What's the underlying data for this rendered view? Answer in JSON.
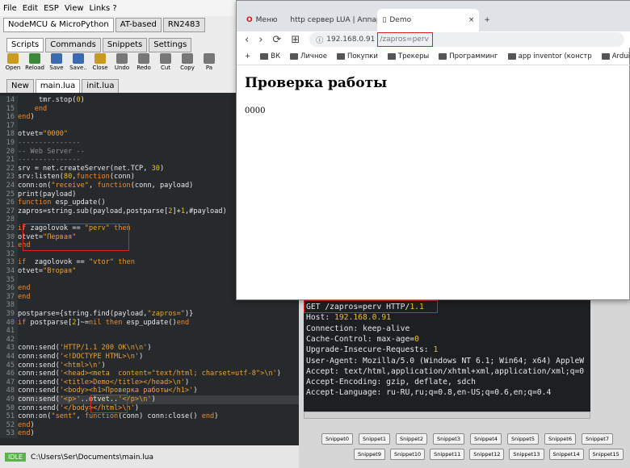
{
  "ide": {
    "menu": [
      "File",
      "Edit",
      "ESP",
      "View",
      "Links ?"
    ],
    "device_tabs": [
      "NodeMCU & MicroPython",
      "AT-based",
      "RN2483"
    ],
    "sub_tabs": [
      "Scripts",
      "Commands",
      "Snippets",
      "Settings"
    ],
    "toolbar": [
      "Open",
      "Reload",
      "Save",
      "Save..",
      "Close",
      "Undo",
      "Redo",
      "Cut",
      "Copy",
      "Pa"
    ],
    "file_tabs": [
      "New",
      "main.lua",
      "init.lua"
    ],
    "status": {
      "state": "IDLE",
      "path": "C:\\Users\\Ser\\Documents\\main.lua"
    },
    "code_lines": [
      {
        "n": "14",
        "t": "     tmr.stop(0)"
      },
      {
        "n": "15",
        "t": "    end"
      },
      {
        "n": "16",
        "t": "end)"
      },
      {
        "n": "17",
        "t": ""
      },
      {
        "n": "18",
        "t": "otvet=\"0000\""
      },
      {
        "n": "19",
        "t": "---------------"
      },
      {
        "n": "20",
        "t": "-- Web Server --"
      },
      {
        "n": "21",
        "t": "---------------"
      },
      {
        "n": "22",
        "t": "srv = net.createServer(net.TCP, 30)"
      },
      {
        "n": "23",
        "t": "srv:listen(80,function(conn)"
      },
      {
        "n": "24",
        "t": "conn:on(\"receive\", function(conn, payload)"
      },
      {
        "n": "25",
        "t": "print(payload)"
      },
      {
        "n": "26",
        "t": "function esp_update()"
      },
      {
        "n": "27",
        "t": "zapros=string.sub(payload,postparse[2]+1,#payload)"
      },
      {
        "n": "28",
        "t": ""
      },
      {
        "n": "29",
        "t": "if zagolovok == \"perv\" then"
      },
      {
        "n": "30",
        "t": "otvet=\"Первая\""
      },
      {
        "n": "31",
        "t": "end"
      },
      {
        "n": "32",
        "t": ""
      },
      {
        "n": "33",
        "t": "if  zagolovok == \"vtor\" then"
      },
      {
        "n": "34",
        "t": "otvet=\"Вторая\""
      },
      {
        "n": "35",
        "t": ""
      },
      {
        "n": "36",
        "t": "end"
      },
      {
        "n": "37",
        "t": "end"
      },
      {
        "n": "38",
        "t": ""
      },
      {
        "n": "39",
        "t": "postparse={string.find(payload,\"zapros=\")}"
      },
      {
        "n": "40",
        "t": "if postparse[2]~=nil then esp_update()end"
      },
      {
        "n": "41",
        "t": ""
      },
      {
        "n": "42",
        "t": ""
      },
      {
        "n": "43",
        "t": "conn:send('HTTP/1.1 200 OK\\n\\n')"
      },
      {
        "n": "44",
        "t": "conn:send('<!DOCTYPE HTML>\\n')"
      },
      {
        "n": "45",
        "t": "conn:send('<html>\\n')"
      },
      {
        "n": "46",
        "t": "conn:send('<head><meta  content=\"text/html; charset=utf-8\">\\n')"
      },
      {
        "n": "47",
        "t": "conn:send('<title>Demo</title></head>\\n')"
      },
      {
        "n": "48",
        "t": "conn:send('<body><h1>Проверка работы</h1>')"
      },
      {
        "n": "49",
        "t": "conn:send('<p>'..otvet..'</p>\\n')"
      },
      {
        "n": "50",
        "t": "conn:send('</body></html>\\n')"
      },
      {
        "n": "51",
        "t": "conn:on(\"sent\", function(conn) conn:close() end)"
      },
      {
        "n": "52",
        "t": "end)"
      },
      {
        "n": "53",
        "t": "end)"
      }
    ]
  },
  "browser": {
    "tabs": [
      "Меню",
      "http сервер LUA | Аппар",
      "Demo"
    ],
    "address_host": "192.168.0.91",
    "address_path": "/zapros=perv",
    "bookmarks": [
      "ВК",
      "Личное",
      "Покупки",
      "Трекеры",
      "Программинг",
      "app inventor (констр",
      "Arduino"
    ],
    "page_heading": "Проверка работы",
    "page_text": "0000"
  },
  "serial": {
    "lines": [
      {
        "k": "GET /zapros=perv HTTP/",
        "v": "1.1"
      },
      {
        "k": "Host: ",
        "v": "192.168.0.91"
      },
      {
        "k": "Connection: keep-alive",
        "v": ""
      },
      {
        "k": "Cache-Control: max-age=",
        "v": "0"
      },
      {
        "k": "Upgrade-Insecure-Requests: ",
        "v": "1"
      },
      {
        "k": "User-Agent: Mozilla/5.0 (Windows NT 6.1; Win64; x64) AppleW",
        "v": ""
      },
      {
        "k": "Accept: text/html,application/xhtml+xml,application/xml;q=0",
        "v": ""
      },
      {
        "k": "Accept-Encoding: gzip, deflate, sdch",
        "v": ""
      },
      {
        "k": "Accept-Language: ru-RU,ru;q=0.8,en-US;q=0.6,en;q=0.4",
        "v": ""
      }
    ],
    "snippets_row1": [
      "Snippet0",
      "Snippet1",
      "Snippet2",
      "Snippet3",
      "Snippet4",
      "Snippet5",
      "Snippet6",
      "Snippet7"
    ],
    "snippets_row2": [
      "Snippet9",
      "Snippet10",
      "Snippet11",
      "Snippet12",
      "Snippet13",
      "Snippet14",
      "Snippet15"
    ]
  },
  "colors": {
    "highlight_box": "#e0201a",
    "editor_bg": "#262a2c",
    "string": "#f0a030"
  }
}
